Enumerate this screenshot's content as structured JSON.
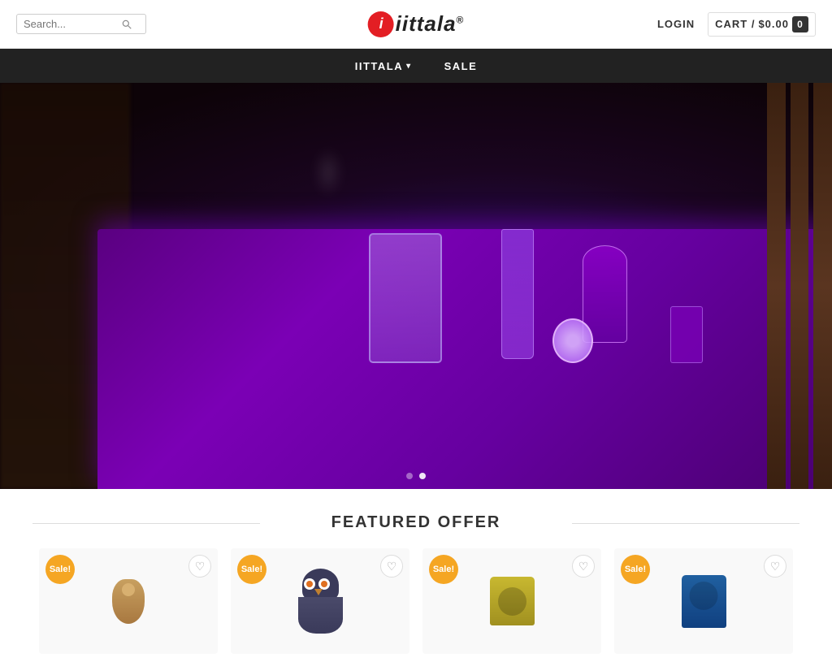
{
  "header": {
    "search_placeholder": "Search...",
    "login_label": "LOGIN",
    "cart_label": "CART /",
    "cart_price": "$0.00",
    "cart_count": "0"
  },
  "logo": {
    "letter": "i",
    "brand": "iittala",
    "registered": "®"
  },
  "nav": {
    "items": [
      {
        "label": "IITTALA",
        "has_dropdown": true
      },
      {
        "label": "SALE",
        "has_dropdown": false
      }
    ]
  },
  "hero": {
    "dots": [
      {
        "active": false
      },
      {
        "active": true
      }
    ]
  },
  "featured": {
    "title": "FEATURED OFFER",
    "products": [
      {
        "sale_badge": "Sale!",
        "type": "bird",
        "wishlist": "♡"
      },
      {
        "sale_badge": "Sale!",
        "type": "owl",
        "wishlist": "♡"
      },
      {
        "sale_badge": "Sale!",
        "type": "candle-gold",
        "wishlist": "♡"
      },
      {
        "sale_badge": "Sale!",
        "type": "candle-blue",
        "wishlist": "♡"
      }
    ]
  },
  "icons": {
    "search": "🔍",
    "heart": "♡",
    "chevron_down": "▾"
  }
}
